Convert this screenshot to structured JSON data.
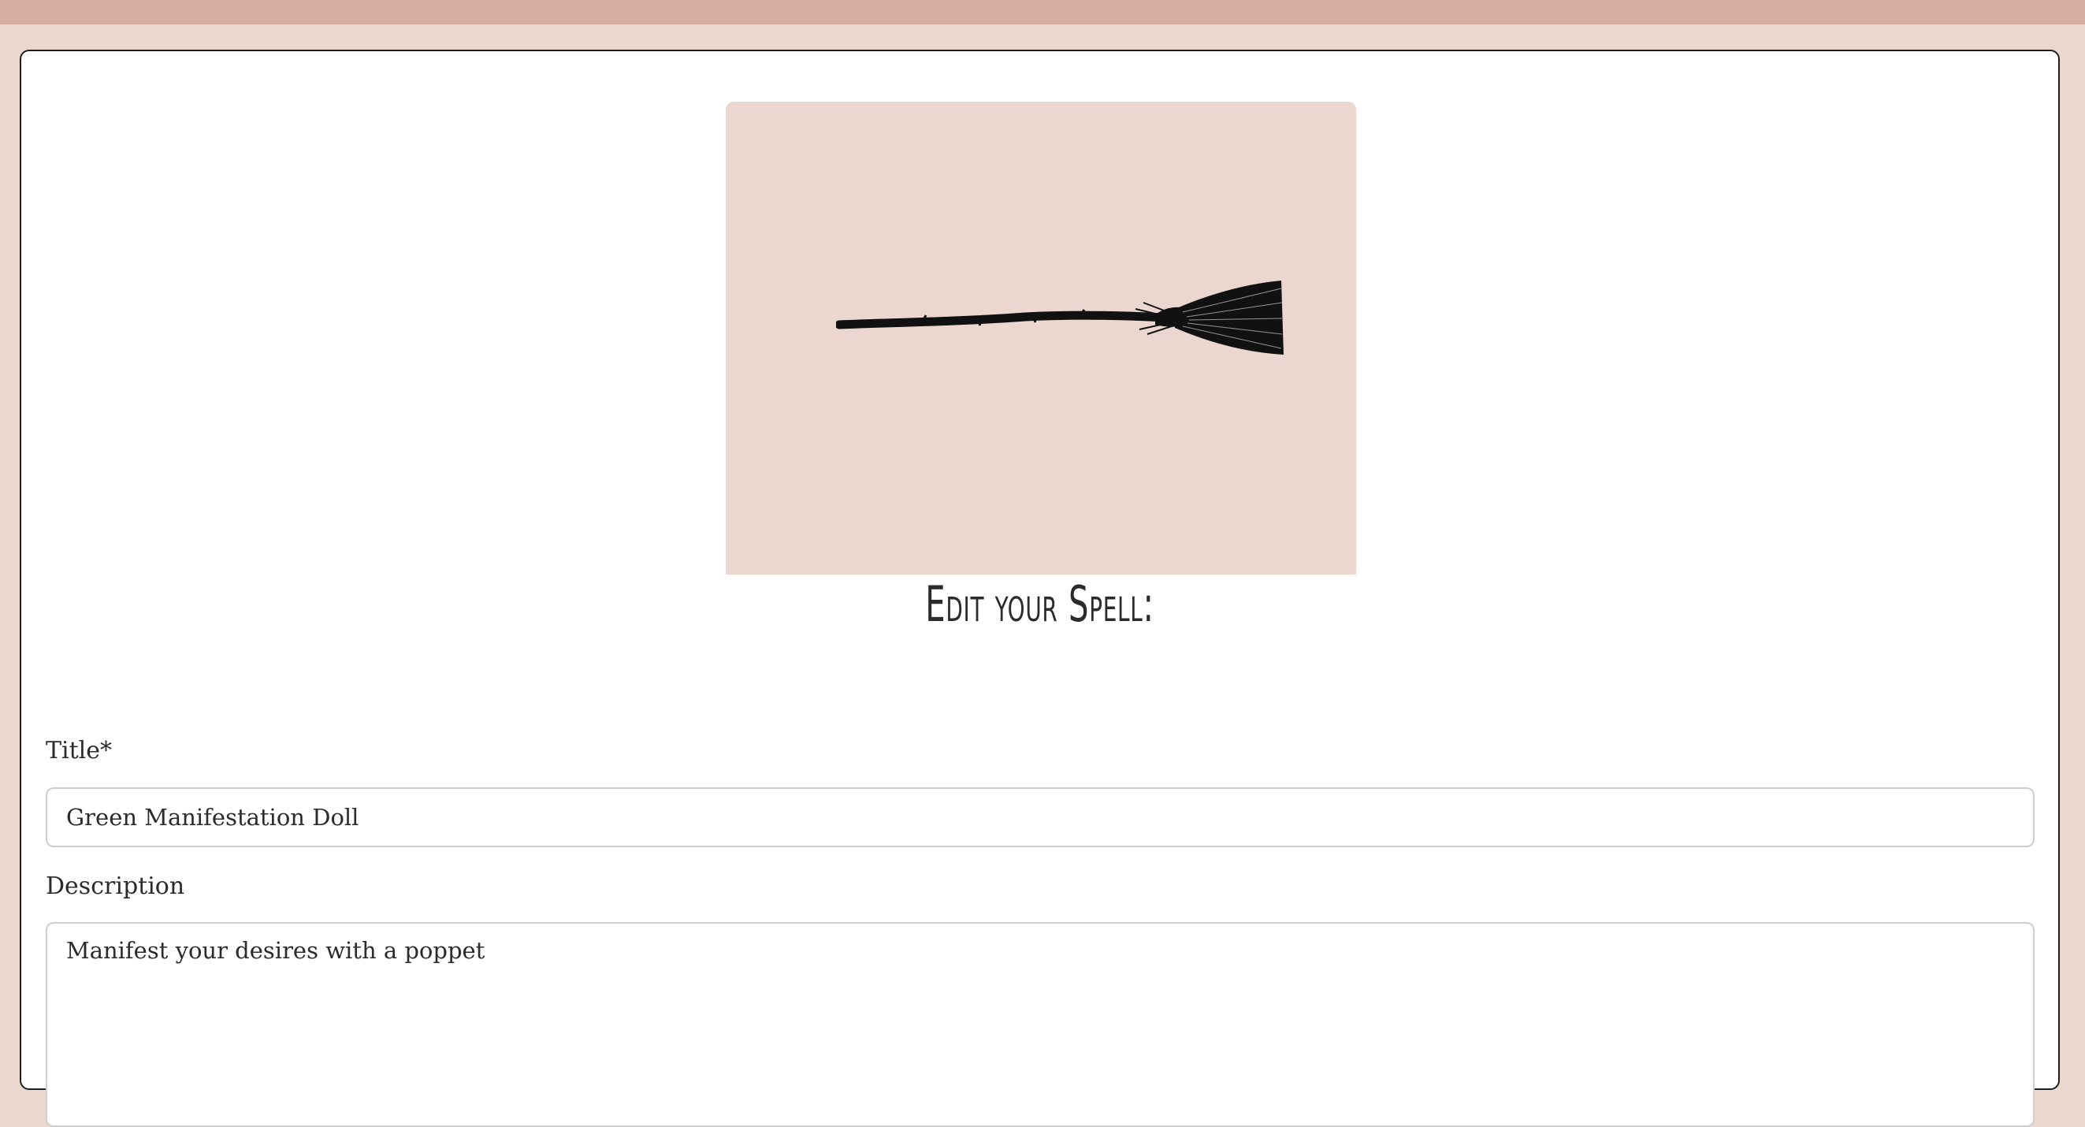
{
  "page": {
    "heading": "Edit your Spell:"
  },
  "form": {
    "title_label": "Title*",
    "title_value": "Green Manifestation Doll",
    "description_label": "Description",
    "description_value": "Manifest your desires with a poppet"
  },
  "image": {
    "icon": "broom-icon"
  },
  "colors": {
    "background": "#ecd6d0",
    "top_bar": "#d9aea3",
    "image_panel": "#ebd6d0",
    "card": "#ffffff"
  }
}
